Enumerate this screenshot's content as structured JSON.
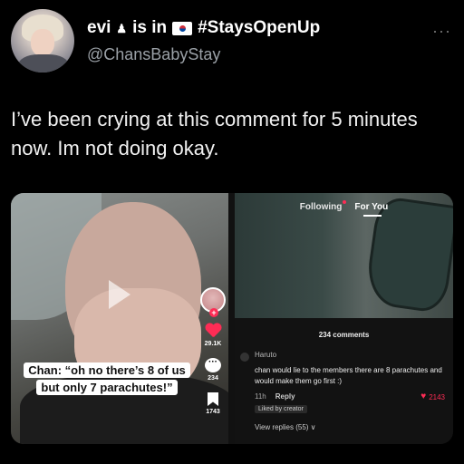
{
  "tweet": {
    "display_name": "evi",
    "is_in": "is in",
    "hashtag": "#StaysOpenUp",
    "handle": "@ChansBabyStay",
    "more": "···",
    "text": "I’ve been crying at this comment for 5 minutes now. Im not doing okay."
  },
  "tiktok_left": {
    "caption": "Chan: “oh no there’s 8 of us but only 7 parachutes!”",
    "likes": "29.1K",
    "comments": "234",
    "saves": "1743"
  },
  "tiktok_right": {
    "tab_following": "Following",
    "tab_foryou": "For You",
    "comments_title": "234 comments",
    "comment": {
      "author": "Haruto",
      "text": "chan would lie to the members there are 8 parachutes and would make them go first :)",
      "time": "11h",
      "reply": "Reply",
      "likes": "2143",
      "liked_by": "Liked by creator",
      "view_replies": "View replies (55) ∨"
    }
  },
  "colors": {
    "tiktok_red": "#fe2c55",
    "handle_gray": "#9aa0a6"
  },
  "icons": [
    "avatar",
    "pin-icon",
    "flag-icon",
    "more-icon",
    "play-icon",
    "heart-icon",
    "comment-icon",
    "bookmark-icon"
  ]
}
